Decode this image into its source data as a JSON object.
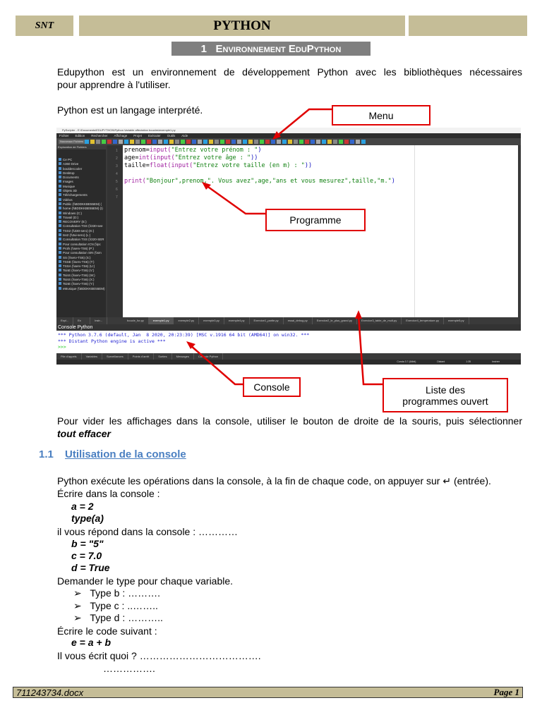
{
  "header": {
    "left": "SNT",
    "title": "PYTHON",
    "right": ""
  },
  "section1": {
    "title": "1   Environnement EduPython"
  },
  "intro": {
    "line1": "Edupython est un environnement de développement Python avec les bibliothèques nécessaires",
    "line2": "pour apprendre à l'utiliser.",
    "line3": "Python est un langage interprété."
  },
  "ide": {
    "titlebar": "PyScripter - E:\\Documents\\EDUPYTHON\\Python Variable affectation boucles\\exemple1.py",
    "menu": [
      "Fichier",
      "Edition",
      "Rechercher",
      "Affichage",
      "Projet",
      "Exécuter",
      "Outils",
      "Aide"
    ],
    "new_folder": "Nouveaux Fichiers",
    "explorer_title": "Exploration de Fichiers",
    "explorer_items": [
      "Ce PC",
      "A360 Drive",
      "bouldercooler",
      "Desktop",
      "Documents",
      "Images",
      "Musique",
      "Objets 3D",
      "Téléchargements",
      "Vidéos",
      "Public (\\\\BDDKKBE55EM) (",
      "home (\\\\BDDKKBE55EM) (I)",
      "Windows (C:)",
      "Travail (D:)",
      "RECOVERY (E:)",
      "Consultation TSS (\\\\330-see",
      "TSS2 (\\\\330-sero) (K:)",
      "tss2 (\\\\3ui-sero) (L:)",
      "Consultation TSS (\\\\320-SER",
      "Pour consultation ICN (\\\\pc",
      "Profs (\\\\serv-TS6) (P:)",
      "Pour consultation SIN (\\\\sm",
      "SS (\\\\serv-TS6) (S:)",
      "TSSE (\\\\serv-TS6) (T:)",
      "TSSA (\\\\serv-TS6) (U:)",
      "TsinE (\\\\serv-TS6) (V:)",
      "TsinS (\\\\serv-TS6) (W:)",
      "TsinS (\\\\serv-TS6) (X:)",
      "TsinE (\\\\serv-TS6) (Y:)",
      "eMusique (\\\\BDDKKBE55EM)"
    ],
    "line_numbers": [
      "1",
      "2",
      "3",
      "4",
      "5",
      "6",
      "7"
    ],
    "code": [
      {
        "a": "prenom=",
        "b": "input(",
        "s": "\"Entrez votre prénom : \"",
        "c": ")"
      },
      {
        "a": "age=",
        "b": "int(input(",
        "s": "\"Entrez votre âge : \"",
        "c": "))"
      },
      {
        "a": "taille=",
        "b": "float(input(",
        "s": "\"Entrez votre taille (en m) : \"",
        "c": "))"
      },
      {
        "a": "",
        "b": "",
        "s": "",
        "c": ""
      },
      {
        "a": "",
        "b": "print(",
        "s": "\"Bonjour\",prenom,\". Vous avez\",age,\"ans et vous mesurez\",taille,\"m.\"",
        "c": ")"
      }
    ],
    "left_tabs": [
      "Expl...",
      "Ex pl...",
      "Instr..."
    ],
    "file_tabs": [
      "boucle_for.py",
      "exemple1.py",
      "exemple2.py",
      "exemple3.py",
      "exemple4.py",
      "Exercice1_parite.py",
      "essai_debug.py",
      "Exercice2_le_plus_grand.py",
      "Exercice3_table_de_mult.py",
      "Exercice4_temperature.py",
      "exemple5.py"
    ],
    "console_title": "Console Python",
    "console_lines": [
      "*** Python 3.7.6 (default, Jan  8 2020, 20:23:39) [MSC v.1916 64 bit (AMD64)] on win32. ***",
      "*** Distant Python engine is active ***",
      ">>>"
    ],
    "bottom_tabs": [
      "Pile d'appels",
      "Variables",
      "Surveillances",
      "Points d'arrêt",
      "Sorties",
      "Messages",
      "Console Python"
    ],
    "status": [
      "Conda 3.7 (64bit)",
      "Distant",
      "1:35",
      "Insérer"
    ]
  },
  "callouts": {
    "menu": "Menu",
    "programme": "Programme",
    "console": "Console",
    "liste": "Liste des programmes ouvert"
  },
  "after": {
    "line1": "Pour vider les affichages dans la console, utiliser le bouton de droite de la souris, puis sélectionner",
    "line2": "tout effacer"
  },
  "section11": {
    "num": "1.1",
    "title": "Utilisation de la console"
  },
  "body": {
    "l1": "Python exécute les opérations dans la console, à la fin de chaque code, on appuyer sur ↵  (entrée).",
    "l2": "Écrire dans la console :",
    "c1": "a = 2",
    "c2": "type(a)",
    "l3": "il vous répond dans la console :  …………",
    "c3": "b = \"5\"",
    "c4": "c = 7.0",
    "c5": "d = True",
    "l4": "Demander le type pour chaque variable.",
    "bullets": [
      "Type b :  ……….",
      "Type c :  ..……..",
      "Type d :  ……….."
    ],
    "l5": "Écrire le code suivant :",
    "c6": "e = a + b",
    "l6": "Il vous écrit quoi ? ……………………………….",
    "l7": "……………."
  },
  "footer": {
    "file": "711243734.docx",
    "page": "Page 1"
  }
}
